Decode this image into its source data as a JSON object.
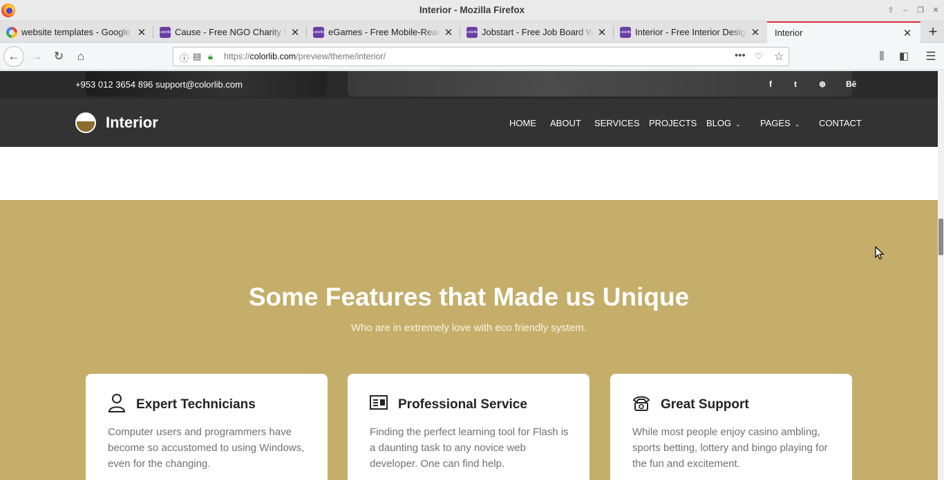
{
  "window": {
    "title": "Interior - Mozilla Firefox"
  },
  "tabs": [
    {
      "label": "website templates - Google S",
      "favicon": "google-icon"
    },
    {
      "label": "Cause - Free NGO Charity We",
      "favicon": "colorlib-icon"
    },
    {
      "label": "eGames - Free Mobile-Ready",
      "favicon": "colorlib-icon"
    },
    {
      "label": "Jobstart - Free Job Board Web",
      "favicon": "colorlib-icon"
    },
    {
      "label": "Interior - Free Interior Design",
      "favicon": "colorlib-icon"
    },
    {
      "label": "Interior",
      "favicon": "none",
      "active": true
    }
  ],
  "favicon_text": "colorlib",
  "urlbar": {
    "prefix": "https://",
    "domain": "colorlib.com",
    "path": "/preview/theme/interior/"
  },
  "site": {
    "phone": "+953 012 3654 896",
    "email": "support@colorlib.com",
    "social": [
      "f",
      "t",
      "⊛",
      "Bē"
    ],
    "brand": "Interior",
    "nav": [
      {
        "label": "HOME"
      },
      {
        "label": "ABOUT"
      },
      {
        "label": "SERVICES"
      },
      {
        "label": "PROJECTS"
      },
      {
        "label": "BLOG",
        "dropdown": true
      },
      {
        "label": "PAGES",
        "dropdown": true
      },
      {
        "label": "CONTACT"
      }
    ]
  },
  "features": {
    "heading": "Some Features that Made us Unique",
    "subheading": "Who are in extremely love with eco friendly system.",
    "cards": [
      {
        "icon": "user-icon",
        "title": "Expert Technicians",
        "text": "Computer users and programmers have become so accustomed to using Windows, even for the changing."
      },
      {
        "icon": "license-icon",
        "title": "Professional Service",
        "text": "Finding the perfect learning tool for Flash is a daunting task to any novice web developer. One can find help."
      },
      {
        "icon": "phone-icon",
        "title": "Great Support",
        "text": "While most people enjoy casino ambling, sports betting, lottery and bingo playing for the fun and excitement."
      }
    ]
  },
  "colors": {
    "accent": "#c4ae69",
    "nav_bg": "#333333",
    "tab_accent": "#e0323d"
  }
}
